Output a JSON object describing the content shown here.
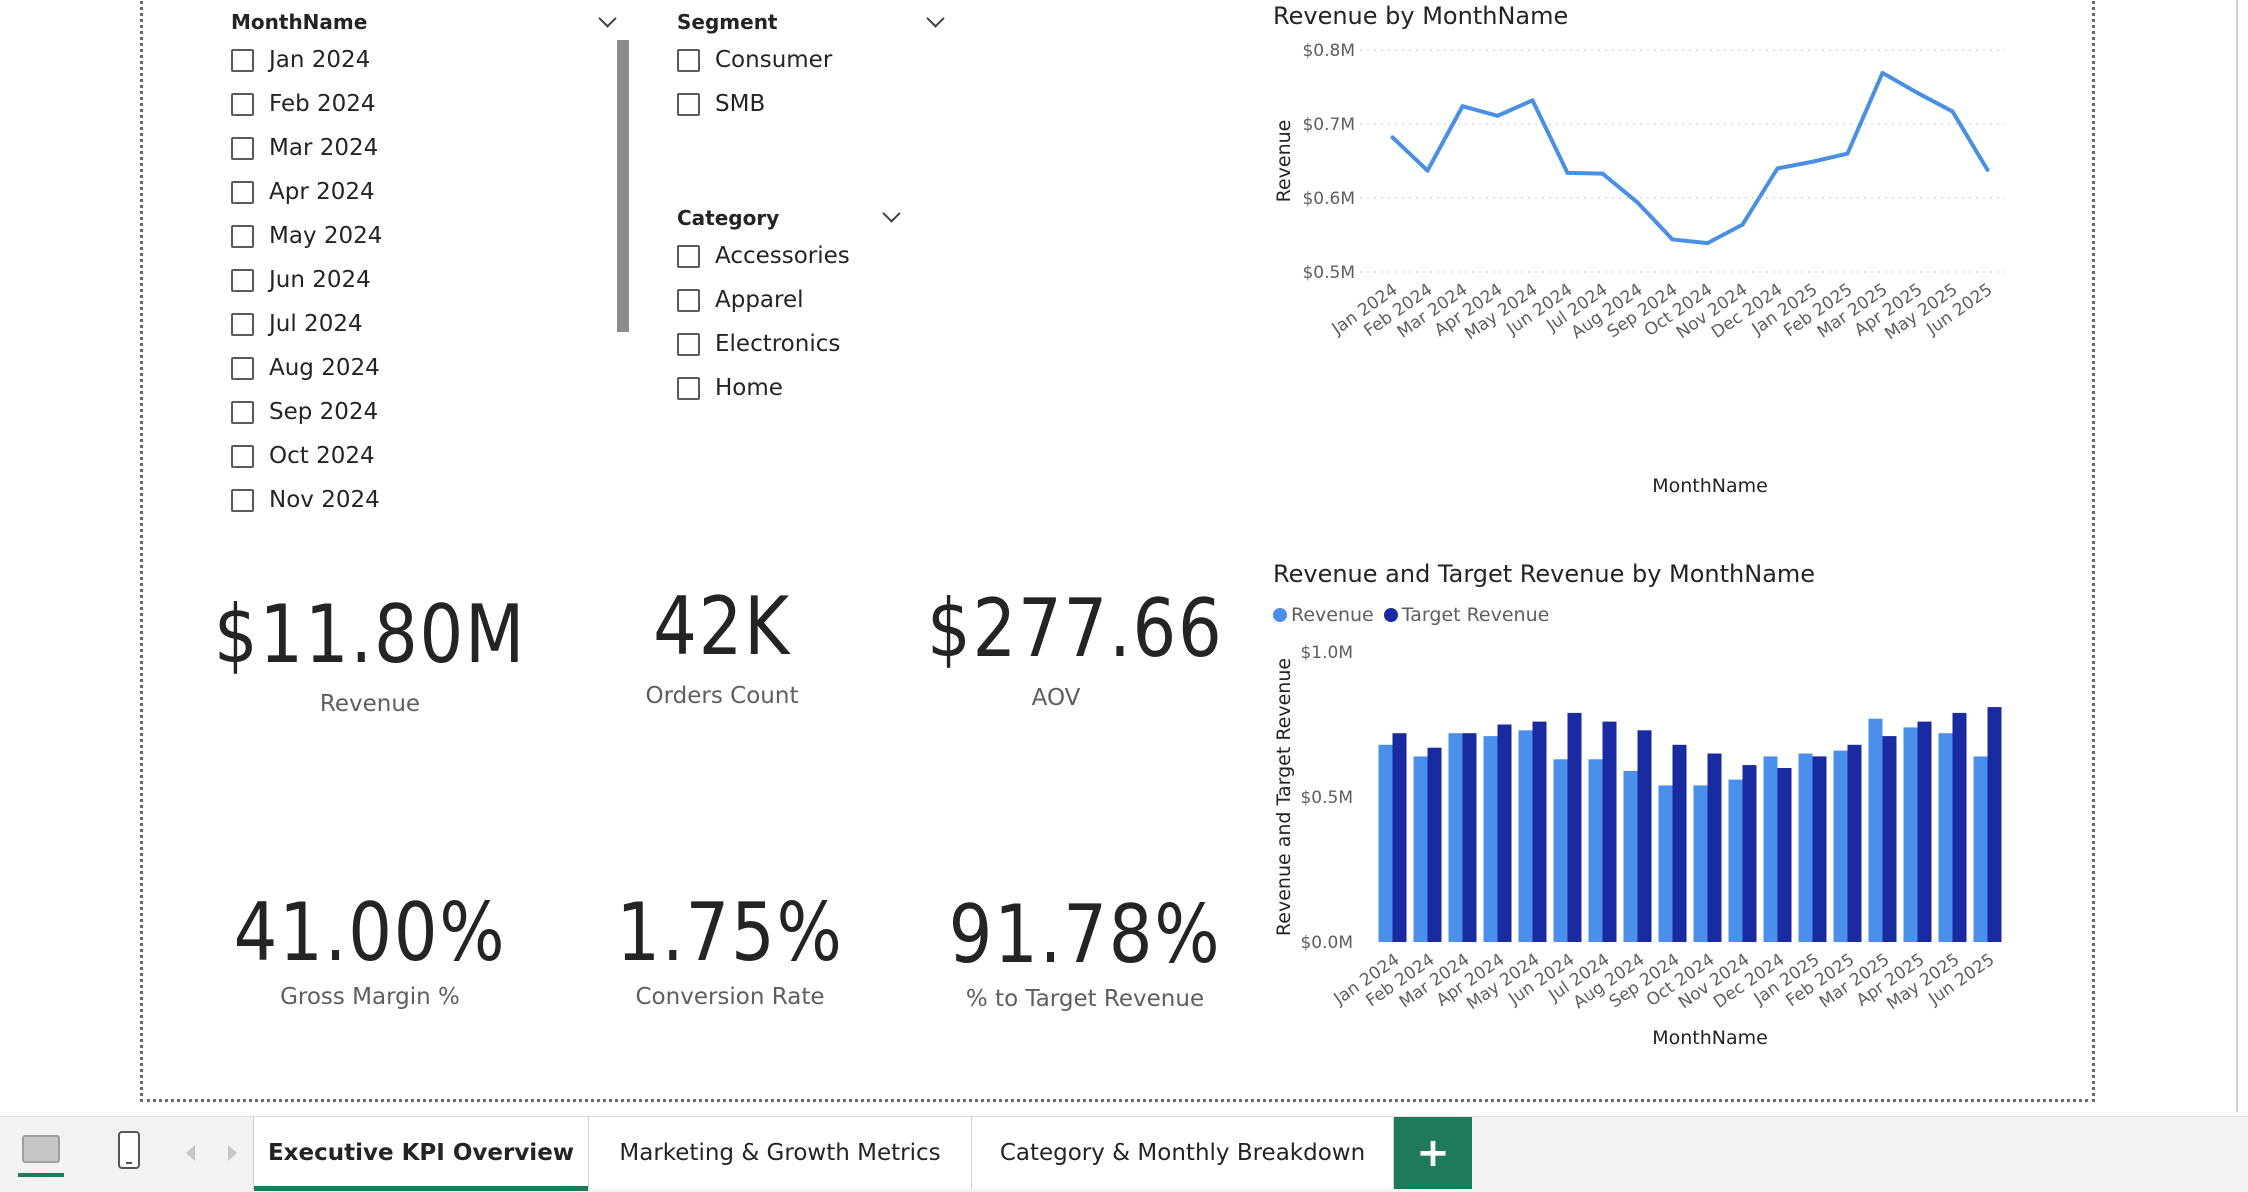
{
  "filters": {
    "month": {
      "header": "MonthName",
      "items": [
        "Jan 2024",
        "Feb 2024",
        "Mar 2024",
        "Apr 2024",
        "May 2024",
        "Jun 2024",
        "Jul 2024",
        "Aug 2024",
        "Sep 2024",
        "Oct 2024",
        "Nov 2024"
      ]
    },
    "segment": {
      "header": "Segment",
      "items": [
        "Consumer",
        "SMB"
      ]
    },
    "category": {
      "header": "Category",
      "items": [
        "Accessories",
        "Apparel",
        "Electronics",
        "Home"
      ]
    }
  },
  "kpis": [
    {
      "value": "$11.80M",
      "label": "Revenue"
    },
    {
      "value": "42K",
      "label": "Orders Count"
    },
    {
      "value": "$277.66",
      "label": "AOV"
    },
    {
      "value": "41.00%",
      "label": "Gross Margin %"
    },
    {
      "value": "1.75%",
      "label": "Conversion Rate"
    },
    {
      "value": "91.78%",
      "label": "% to Target Revenue"
    }
  ],
  "colors": {
    "line": "#4a90e2",
    "revenue": "#4a8fea",
    "target": "#1a2aa0",
    "accent": "#1f7a5c"
  },
  "chart_data": [
    {
      "type": "line",
      "title": "Revenue by MonthName",
      "xlabel": "MonthName",
      "ylabel": "Revenue",
      "categories": [
        "Jan 2024",
        "Feb 2024",
        "Mar 2024",
        "Apr 2024",
        "May 2024",
        "Jun 2024",
        "Jul 2024",
        "Aug 2024",
        "Sep 2024",
        "Oct 2024",
        "Nov 2024",
        "Dec 2024",
        "Jan 2025",
        "Feb 2025",
        "Mar 2025",
        "Apr 2025",
        "May 2025",
        "Jun 2025"
      ],
      "series": [
        {
          "name": "Revenue",
          "values": [
            0.682,
            0.637,
            0.724,
            0.711,
            0.732,
            0.634,
            0.633,
            0.594,
            0.544,
            0.539,
            0.564,
            0.64,
            0.649,
            0.66,
            0.769,
            0.742,
            0.717,
            0.638
          ]
        }
      ],
      "ylim": [
        0.5,
        0.8
      ],
      "yticks": [
        "$0.8M",
        "$0.7M",
        "$0.6M",
        "$0.5M"
      ],
      "ytick_values": [
        0.8,
        0.7,
        0.6,
        0.5
      ],
      "grid": true
    },
    {
      "type": "bar",
      "title": "Revenue and Target Revenue by MonthName",
      "xlabel": "MonthName",
      "ylabel": "Revenue and Target Revenue",
      "legend": "top-left",
      "categories": [
        "Jan 2024",
        "Feb 2024",
        "Mar 2024",
        "Apr 2024",
        "May 2024",
        "Jun 2024",
        "Jul 2024",
        "Aug 2024",
        "Sep 2024",
        "Oct 2024",
        "Nov 2024",
        "Dec 2024",
        "Jan 2025",
        "Feb 2025",
        "Mar 2025",
        "Apr 2025",
        "May 2025",
        "Jun 2025"
      ],
      "series": [
        {
          "name": "Revenue",
          "values": [
            0.68,
            0.64,
            0.72,
            0.71,
            0.73,
            0.63,
            0.63,
            0.59,
            0.54,
            0.54,
            0.56,
            0.64,
            0.65,
            0.66,
            0.77,
            0.74,
            0.72,
            0.64
          ]
        },
        {
          "name": "Target Revenue",
          "values": [
            0.72,
            0.67,
            0.72,
            0.75,
            0.76,
            0.79,
            0.76,
            0.73,
            0.68,
            0.65,
            0.61,
            0.6,
            0.64,
            0.68,
            0.71,
            0.76,
            0.79,
            0.81
          ]
        }
      ],
      "ylim": [
        0,
        1.0
      ],
      "yticks": [
        "$1.0M",
        "$0.5M",
        "$0.0M"
      ],
      "ytick_values": [
        1.0,
        0.5,
        0.0
      ],
      "grid": false
    }
  ],
  "tabs": {
    "pages": [
      "Executive KPI Overview",
      "Marketing & Growth Metrics",
      "Category & Monthly Breakdown"
    ],
    "active": "Executive KPI Overview",
    "add_label": "+"
  }
}
